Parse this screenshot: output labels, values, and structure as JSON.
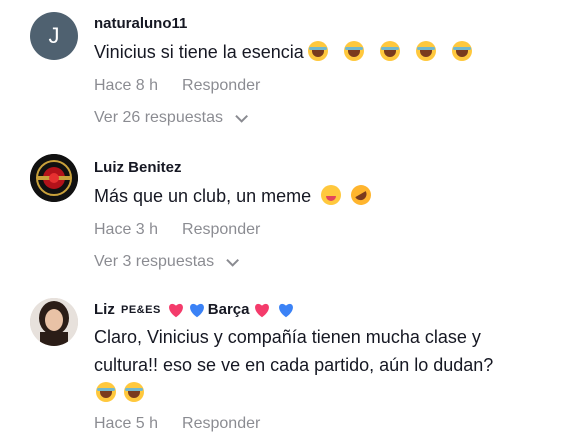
{
  "comments": [
    {
      "avatar_letter": "J",
      "username": "naturaluno11",
      "text": "Vinicius si tiene la esencia",
      "time": "Hace 8 h",
      "reply_label": "Responder",
      "replies_label": "Ver 26 respuestas",
      "emojis": [
        "laughing-crying",
        "laughing-crying",
        "laughing-crying",
        "laughing-crying",
        "laughing-crying"
      ]
    },
    {
      "username": "Luiz Benitez",
      "text": "Más que un club, un meme",
      "time": "Hace 3 h",
      "reply_label": "Responder",
      "replies_label": "Ver 3 respuestas",
      "emojis": [
        "zany-face",
        "rolling-laughing"
      ]
    },
    {
      "username_prefix": "Liz ",
      "username_small": "PE&ES",
      "username_suffix": "Barça",
      "text_line1": "Claro, Vinicius y compañía tienen mucha clase y",
      "text_line2": "cultura!! eso se ve en cada partido, aún lo dudan?",
      "time": "Hace 5 h",
      "reply_label": "Responder",
      "emojis": [
        "laughing-crying",
        "laughing-crying"
      ]
    }
  ],
  "colors": {
    "text": "#161823",
    "muted": "rgba(22,24,35,0.5)",
    "avatar_bg": "#4f6170",
    "heart_pink": "#fe2c55",
    "heart_blue": "#3b82f6"
  }
}
